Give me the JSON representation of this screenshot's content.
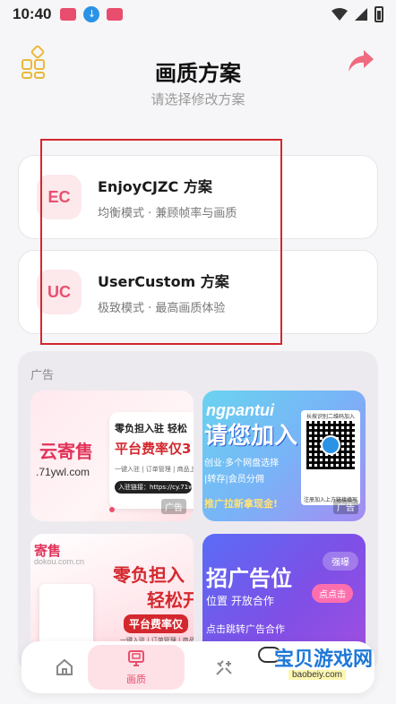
{
  "status_bar": {
    "time": "10:40"
  },
  "header": {
    "title": "画质方案",
    "subtitle": "请选择修改方案"
  },
  "schemes": [
    {
      "badge": "EC",
      "name": "EnjoyCJZC 方案",
      "desc": "均衡模式 · 兼顾帧率与画质"
    },
    {
      "badge": "UC",
      "name": "UserCustom 方案",
      "desc": "极致模式 · 最高画质体验"
    }
  ],
  "ads": {
    "label": "广告",
    "tag": "广告",
    "ad1": {
      "logo": "云寄售",
      "url": ".71ywl.com",
      "line1": "零负担入驻 轻松",
      "line2": "平台费率仅3",
      "line3": "一键入驻 | 订单管理 | 商品上架",
      "line4": "入驻链接：https://cy.71wl"
    },
    "ad2": {
      "top": "ngpantui",
      "big": "请您加入",
      "line1": "创业·多个网盘选择",
      "line2": "|转存|会员分佣",
      "line3": "推广拉新拿现金!",
      "qr_top": "长按识别二维码加入",
      "qr_bottom": "注册加入上方链接填写"
    },
    "ad3": {
      "logo": "寄售",
      "url": "dokou.com.cn",
      "line1": "零负担入",
      "line2": "轻松开",
      "line3": "平台费率仅",
      "line4": "一键入驻 | 订单管理 | 商品上"
    },
    "ad4": {
      "title": "招广告位",
      "line1": "位置 开放合作",
      "line2": "点击跳转广告合作",
      "pill1": "强曝",
      "pill2": "点点击"
    }
  },
  "nav": {
    "quality_label": "画质"
  },
  "watermark": {
    "text": "宝贝游戏网",
    "url": "baobeiy.com"
  },
  "colors": {
    "accent": "#e8506e",
    "highlight_border": "#d3282e",
    "grid_icon": "#e9b93a"
  }
}
